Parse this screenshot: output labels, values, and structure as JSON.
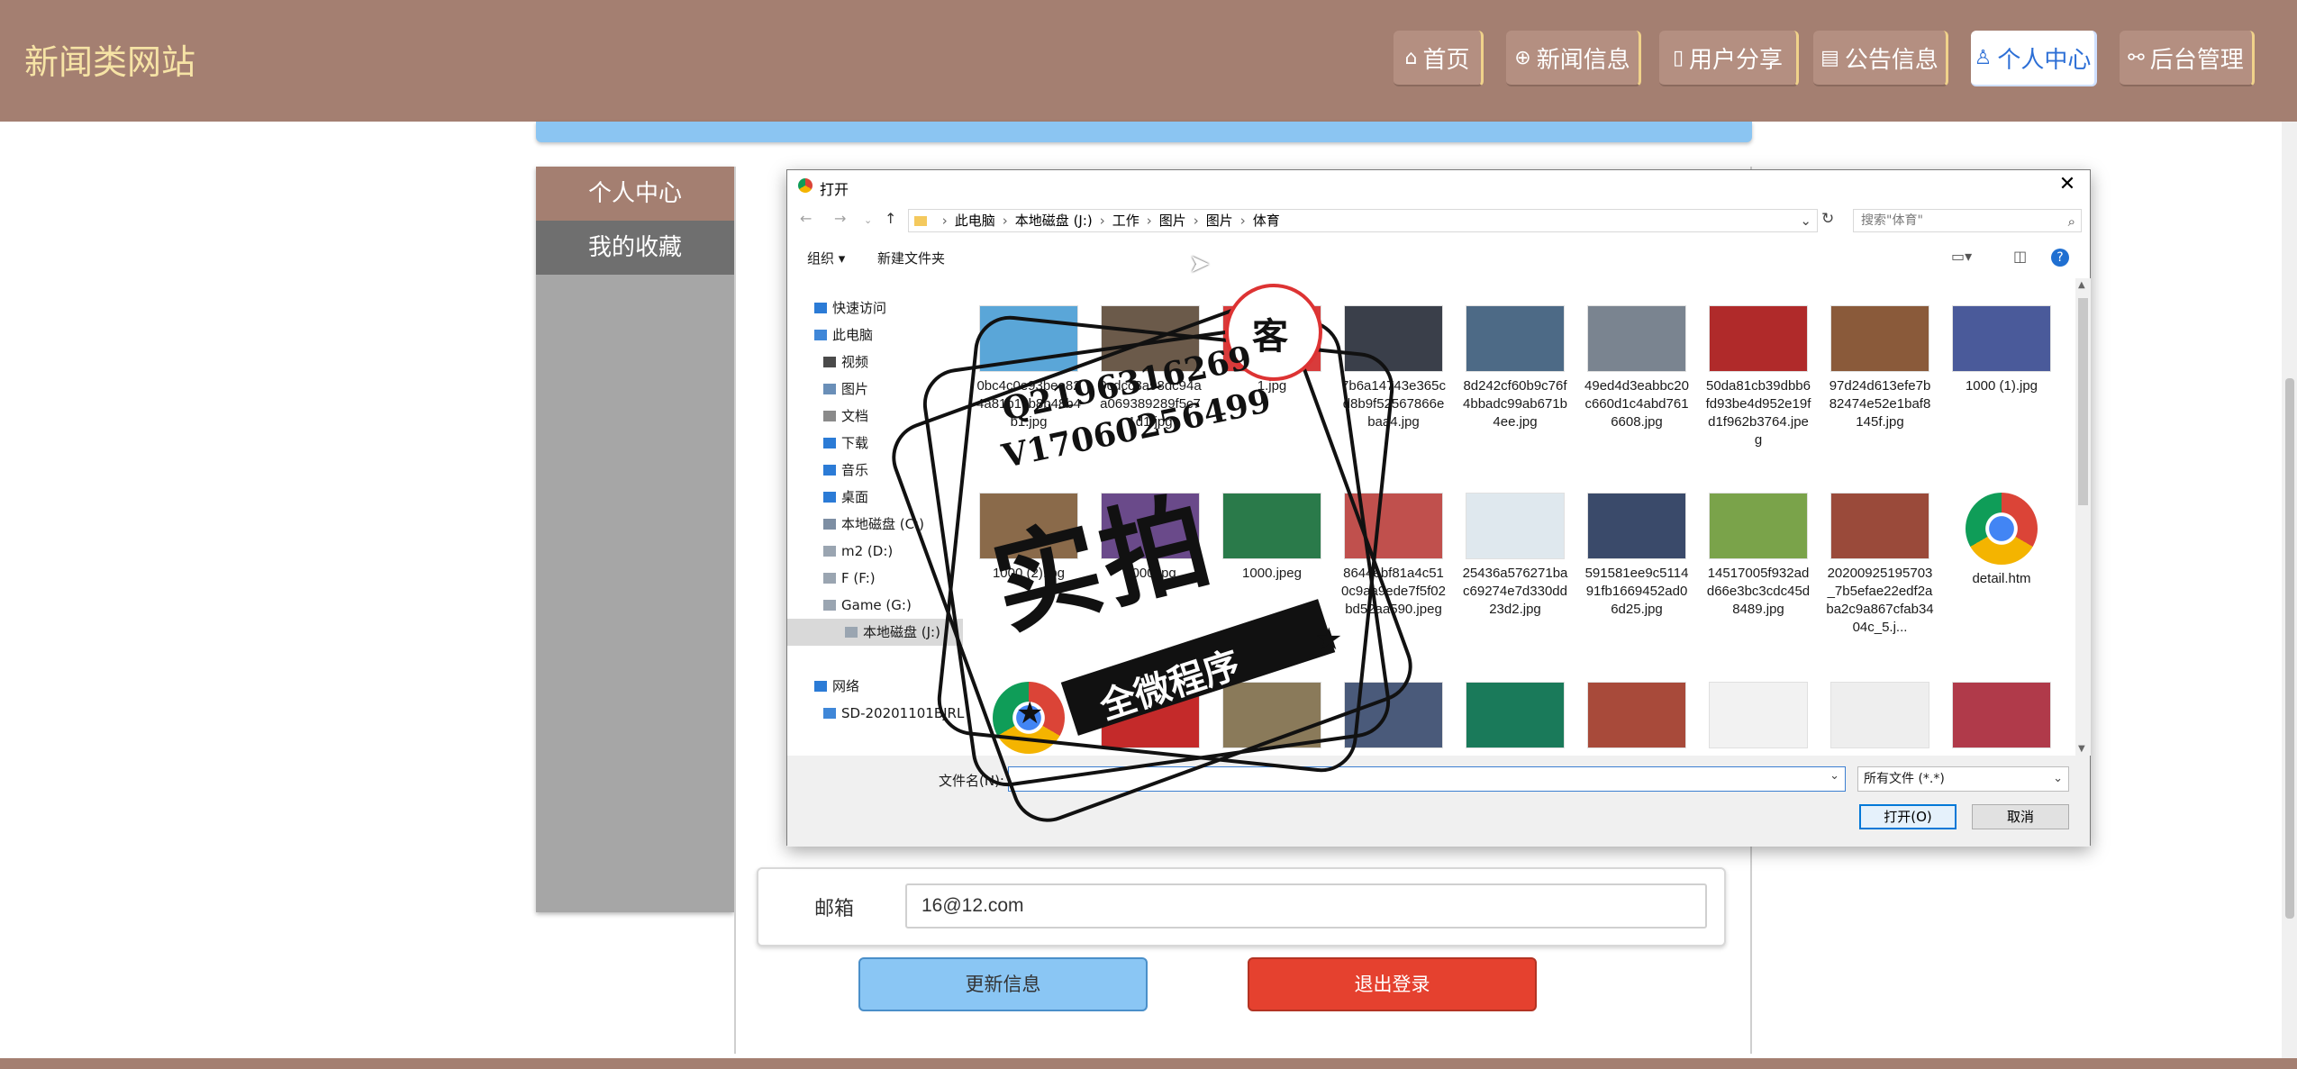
{
  "site": {
    "title": "新闻类网站",
    "nav": [
      {
        "icon": "⌂",
        "label": "首页",
        "active": false
      },
      {
        "icon": "⊕",
        "label": "新闻信息",
        "active": false
      },
      {
        "icon": "▯",
        "label": "用户分享",
        "active": false
      },
      {
        "icon": "▤",
        "label": "公告信息",
        "active": false
      },
      {
        "icon": "♙",
        "label": "个人中心",
        "active": true
      },
      {
        "icon": "⚯",
        "label": "后台管理",
        "active": false
      }
    ],
    "colors": {
      "header": "#a47f71",
      "title": "#f6e3a5",
      "accent_blue": "#8ac6f4",
      "danger": "#e5412f"
    }
  },
  "sidebar": {
    "items": [
      {
        "label": "个人中心"
      },
      {
        "label": "我的收藏"
      }
    ]
  },
  "form": {
    "email_label": "邮箱",
    "email_value": "16@12.com",
    "update_button": "更新信息",
    "logout_button": "退出登录"
  },
  "dialog": {
    "title": "打开",
    "breadcrumb": [
      "此电脑",
      "本地磁盘 (J:)",
      "工作",
      "图片",
      "图片",
      "体育"
    ],
    "search_placeholder": "搜索\"体育\"",
    "toolbar": {
      "organize": "组织 ▾",
      "new_folder": "新建文件夹"
    },
    "tree": [
      {
        "label": "快速访问",
        "icon": "star-icon",
        "color": "#2b7bd6",
        "indent": 0,
        "selected": false
      },
      {
        "label": "此电脑",
        "icon": "computer-icon",
        "color": "#3f87d8",
        "indent": 0,
        "selected": false
      },
      {
        "label": "视频",
        "icon": "video-icon",
        "color": "#4a4a4a",
        "indent": 1,
        "selected": false
      },
      {
        "label": "图片",
        "icon": "picture-icon",
        "color": "#6a8fb8",
        "indent": 1,
        "selected": false
      },
      {
        "label": "文档",
        "icon": "document-icon",
        "color": "#8a8a8a",
        "indent": 1,
        "selected": false
      },
      {
        "label": "下载",
        "icon": "download-icon",
        "color": "#2b7bd6",
        "indent": 1,
        "selected": false
      },
      {
        "label": "音乐",
        "icon": "music-icon",
        "color": "#2b7bd6",
        "indent": 1,
        "selected": false
      },
      {
        "label": "桌面",
        "icon": "desktop-icon",
        "color": "#2b7bd6",
        "indent": 1,
        "selected": false
      },
      {
        "label": "本地磁盘 (C:)",
        "icon": "drive-icon",
        "color": "#7d8ea3",
        "indent": 1,
        "selected": false
      },
      {
        "label": "m2 (D:)",
        "icon": "drive-icon",
        "color": "#9aa5b1",
        "indent": 1,
        "selected": false
      },
      {
        "label": "F (F:)",
        "icon": "drive-icon",
        "color": "#9aa5b1",
        "indent": 1,
        "selected": false
      },
      {
        "label": "Game (G:)",
        "icon": "drive-icon",
        "color": "#9aa5b1",
        "indent": 1,
        "selected": false
      },
      {
        "label": "本地磁盘 (J:)",
        "icon": "drive-icon",
        "color": "#9aa5b1",
        "indent": 1,
        "selected": true
      },
      {
        "label": "网络",
        "icon": "network-icon",
        "color": "#2b7bd6",
        "indent": 0,
        "selected": false
      },
      {
        "label": "SD-20201101BJRL",
        "icon": "computer-icon",
        "color": "#3f87d8",
        "indent": 1,
        "selected": false
      }
    ],
    "files": [
      {
        "name": "0bc4c0e93bee824a81b1cb8b48b4b1.jpg",
        "color": "#5aa6d8",
        "kind": "img"
      },
      {
        "name": "0cdcc3a98dc94aa069389289f5c71d1.jpg",
        "color": "#6b5a4a",
        "kind": "img"
      },
      {
        "name": "1.jpg",
        "color": "#d83b3b",
        "kind": "img"
      },
      {
        "name": "7b6a14743e365cd8b9f52567866ebaa4.jpg",
        "color": "#3a3f4a",
        "kind": "img"
      },
      {
        "name": "8d242cf60b9c76f4bbadc99ab671b4ee.jpg",
        "color": "#4d6a86",
        "kind": "img"
      },
      {
        "name": "49ed4d3eabbc20c660d1c4abd7616608.jpg",
        "color": "#7a8490",
        "kind": "img"
      },
      {
        "name": "50da81cb39dbb6fd93be4d952e19fd1f962b3764.jpeg",
        "color": "#b02a2a",
        "kind": "img"
      },
      {
        "name": "97d24d613efe7b82474e52e1baf8145f.jpg",
        "color": "#8a5a3a",
        "kind": "img"
      },
      {
        "name": "1000 (1).jpg",
        "color": "#4a5a9a",
        "kind": "img"
      },
      {
        "name": "1000 (2).jpg",
        "color": "#8a6a4a",
        "kind": "img"
      },
      {
        "name": "1000.jpg",
        "color": "#6a4a8a",
        "kind": "img"
      },
      {
        "name": "1000.jpeg",
        "color": "#2a7a4a",
        "kind": "img"
      },
      {
        "name": "8644ebf81a4c510c9aa9ede7f5f02bd52aa590.jpeg",
        "color": "#c0504d",
        "kind": "img"
      },
      {
        "name": "25436a576271bac69274e7d330dd23d2.jpg",
        "color": "#dfe8ee",
        "kind": "img"
      },
      {
        "name": "591581ee9c511491fb1669452ad06d25.jpg",
        "color": "#3a4a6a",
        "kind": "img"
      },
      {
        "name": "14517005f932add66e3bc3cdc45d8489.jpg",
        "color": "#7aa34a",
        "kind": "img"
      },
      {
        "name": "20200925195703_7b5efae22edf2aba2c9a867cfab3404c_5.j...",
        "color": "#9a4a3a",
        "kind": "img"
      },
      {
        "name": "detail.htm",
        "color": "#2f6fd6",
        "kind": "chrome"
      },
      {
        "name": "",
        "color": "#2f6fd6",
        "kind": "chrome"
      },
      {
        "name": "",
        "color": "#c42a2a",
        "kind": "img"
      },
      {
        "name": "",
        "color": "#8a7a5a",
        "kind": "img"
      },
      {
        "name": "",
        "color": "#4a5a7a",
        "kind": "img"
      },
      {
        "name": "",
        "color": "#1a7a5a",
        "kind": "img"
      },
      {
        "name": "",
        "color": "#a84a3a",
        "kind": "img"
      },
      {
        "name": "",
        "color": "#f2f2f2",
        "kind": "img"
      },
      {
        "name": "",
        "color": "#eeeeee",
        "kind": "img"
      },
      {
        "name": "",
        "color": "#b03a4a",
        "kind": "img"
      }
    ],
    "filename_label": "文件名(N):",
    "filename_value": "",
    "filetype_value": "所有文件 (*.*)",
    "open_button": "打开(O)",
    "cancel_button": "取消"
  },
  "watermark": {
    "phone": "Q2196316269",
    "wechat": "V17060256499",
    "big_text": "实拍",
    "ribbon_text": "全微程序",
    "seal_text": "客"
  }
}
